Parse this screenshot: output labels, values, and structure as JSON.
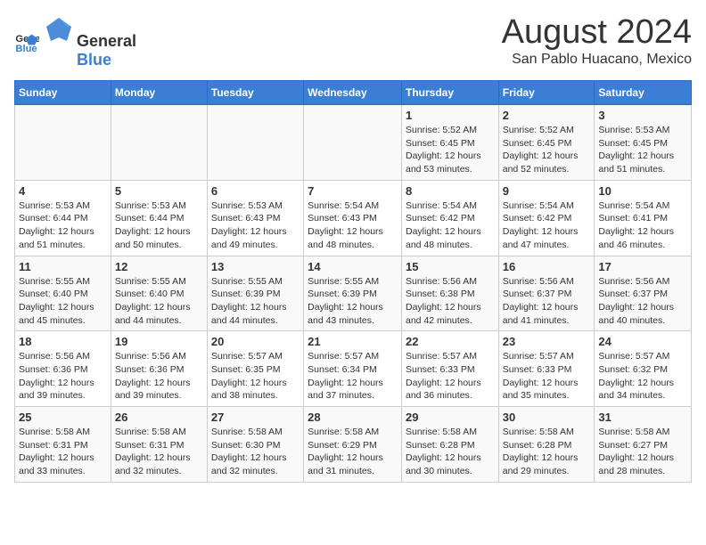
{
  "header": {
    "logo_general": "General",
    "logo_blue": "Blue",
    "title": "August 2024",
    "subtitle": "San Pablo Huacano, Mexico"
  },
  "days_of_week": [
    "Sunday",
    "Monday",
    "Tuesday",
    "Wednesday",
    "Thursday",
    "Friday",
    "Saturday"
  ],
  "weeks": [
    [
      {
        "day": "",
        "info": ""
      },
      {
        "day": "",
        "info": ""
      },
      {
        "day": "",
        "info": ""
      },
      {
        "day": "",
        "info": ""
      },
      {
        "day": "1",
        "info": "Sunrise: 5:52 AM\nSunset: 6:45 PM\nDaylight: 12 hours\nand 53 minutes."
      },
      {
        "day": "2",
        "info": "Sunrise: 5:52 AM\nSunset: 6:45 PM\nDaylight: 12 hours\nand 52 minutes."
      },
      {
        "day": "3",
        "info": "Sunrise: 5:53 AM\nSunset: 6:45 PM\nDaylight: 12 hours\nand 51 minutes."
      }
    ],
    [
      {
        "day": "4",
        "info": "Sunrise: 5:53 AM\nSunset: 6:44 PM\nDaylight: 12 hours\nand 51 minutes."
      },
      {
        "day": "5",
        "info": "Sunrise: 5:53 AM\nSunset: 6:44 PM\nDaylight: 12 hours\nand 50 minutes."
      },
      {
        "day": "6",
        "info": "Sunrise: 5:53 AM\nSunset: 6:43 PM\nDaylight: 12 hours\nand 49 minutes."
      },
      {
        "day": "7",
        "info": "Sunrise: 5:54 AM\nSunset: 6:43 PM\nDaylight: 12 hours\nand 48 minutes."
      },
      {
        "day": "8",
        "info": "Sunrise: 5:54 AM\nSunset: 6:42 PM\nDaylight: 12 hours\nand 48 minutes."
      },
      {
        "day": "9",
        "info": "Sunrise: 5:54 AM\nSunset: 6:42 PM\nDaylight: 12 hours\nand 47 minutes."
      },
      {
        "day": "10",
        "info": "Sunrise: 5:54 AM\nSunset: 6:41 PM\nDaylight: 12 hours\nand 46 minutes."
      }
    ],
    [
      {
        "day": "11",
        "info": "Sunrise: 5:55 AM\nSunset: 6:40 PM\nDaylight: 12 hours\nand 45 minutes."
      },
      {
        "day": "12",
        "info": "Sunrise: 5:55 AM\nSunset: 6:40 PM\nDaylight: 12 hours\nand 44 minutes."
      },
      {
        "day": "13",
        "info": "Sunrise: 5:55 AM\nSunset: 6:39 PM\nDaylight: 12 hours\nand 44 minutes."
      },
      {
        "day": "14",
        "info": "Sunrise: 5:55 AM\nSunset: 6:39 PM\nDaylight: 12 hours\nand 43 minutes."
      },
      {
        "day": "15",
        "info": "Sunrise: 5:56 AM\nSunset: 6:38 PM\nDaylight: 12 hours\nand 42 minutes."
      },
      {
        "day": "16",
        "info": "Sunrise: 5:56 AM\nSunset: 6:37 PM\nDaylight: 12 hours\nand 41 minutes."
      },
      {
        "day": "17",
        "info": "Sunrise: 5:56 AM\nSunset: 6:37 PM\nDaylight: 12 hours\nand 40 minutes."
      }
    ],
    [
      {
        "day": "18",
        "info": "Sunrise: 5:56 AM\nSunset: 6:36 PM\nDaylight: 12 hours\nand 39 minutes."
      },
      {
        "day": "19",
        "info": "Sunrise: 5:56 AM\nSunset: 6:36 PM\nDaylight: 12 hours\nand 39 minutes."
      },
      {
        "day": "20",
        "info": "Sunrise: 5:57 AM\nSunset: 6:35 PM\nDaylight: 12 hours\nand 38 minutes."
      },
      {
        "day": "21",
        "info": "Sunrise: 5:57 AM\nSunset: 6:34 PM\nDaylight: 12 hours\nand 37 minutes."
      },
      {
        "day": "22",
        "info": "Sunrise: 5:57 AM\nSunset: 6:33 PM\nDaylight: 12 hours\nand 36 minutes."
      },
      {
        "day": "23",
        "info": "Sunrise: 5:57 AM\nSunset: 6:33 PM\nDaylight: 12 hours\nand 35 minutes."
      },
      {
        "day": "24",
        "info": "Sunrise: 5:57 AM\nSunset: 6:32 PM\nDaylight: 12 hours\nand 34 minutes."
      }
    ],
    [
      {
        "day": "25",
        "info": "Sunrise: 5:58 AM\nSunset: 6:31 PM\nDaylight: 12 hours\nand 33 minutes."
      },
      {
        "day": "26",
        "info": "Sunrise: 5:58 AM\nSunset: 6:31 PM\nDaylight: 12 hours\nand 32 minutes."
      },
      {
        "day": "27",
        "info": "Sunrise: 5:58 AM\nSunset: 6:30 PM\nDaylight: 12 hours\nand 32 minutes."
      },
      {
        "day": "28",
        "info": "Sunrise: 5:58 AM\nSunset: 6:29 PM\nDaylight: 12 hours\nand 31 minutes."
      },
      {
        "day": "29",
        "info": "Sunrise: 5:58 AM\nSunset: 6:28 PM\nDaylight: 12 hours\nand 30 minutes."
      },
      {
        "day": "30",
        "info": "Sunrise: 5:58 AM\nSunset: 6:28 PM\nDaylight: 12 hours\nand 29 minutes."
      },
      {
        "day": "31",
        "info": "Sunrise: 5:58 AM\nSunset: 6:27 PM\nDaylight: 12 hours\nand 28 minutes."
      }
    ]
  ]
}
